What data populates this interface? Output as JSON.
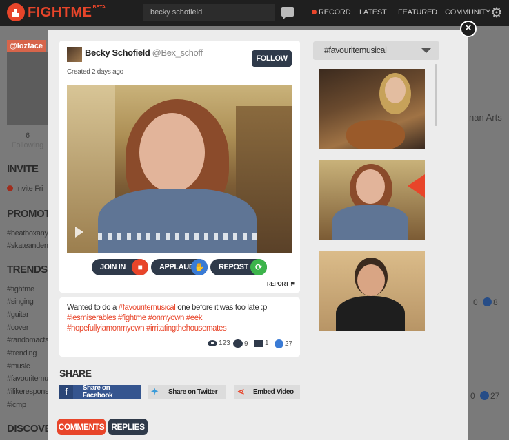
{
  "topbar": {
    "logo_text": "FIGHTME",
    "beta": "BETA",
    "search_value": "becky schofield",
    "nav": [
      "RECORD",
      "LATEST",
      "FEATURED",
      "COMMUNITY"
    ],
    "accent_color": "#e8452a"
  },
  "background": {
    "handle": "@lozface",
    "stat_value": "6",
    "stat_label": "Following",
    "invite_heading": "INVITE",
    "invite_link": "Invite Fri",
    "promoted_heading": "PROMOTED",
    "promoted": [
      "#beatboxanyv",
      "#skateandenj"
    ],
    "trends_heading": "TRENDS",
    "trends": [
      "#fightme",
      "#singing",
      "#guitar",
      "#cover",
      "#randomacts",
      "#trending",
      "#music",
      "#favouritemu",
      "#ilikerespons",
      "#icmp"
    ],
    "discover_heading": "DISCOVER",
    "right_text": "nan Arts",
    "right_count_a_left": "0",
    "right_count_a_right": "8",
    "right_count_b_left": "0",
    "right_count_b_right": "27"
  },
  "post": {
    "user_name": "Becky Schofield",
    "user_handle": "@Bex_schoff",
    "created": "Created 2 days ago",
    "follow_label": "FOLLOW",
    "actions": {
      "join": "JOIN IN",
      "applaud": "APPLAUD",
      "repost": "REPOST"
    },
    "report": "REPORT",
    "desc_prefix": "Wanted to do a ",
    "desc_tag": "#favouritemusical",
    "desc_suffix": " one before it was too late :p",
    "tags_line1": "#lesmiserables #fightme #onmyown #eek",
    "tags_line2": "#hopefullyiamonmyown #irritatingthehousemates",
    "stats": {
      "views": "123",
      "comments": "9",
      "joins": "1",
      "applauds": "27"
    }
  },
  "share": {
    "heading": "SHARE",
    "facebook": "Share on Facebook",
    "twitter": "Share on Twitter",
    "embed": "Embed Video"
  },
  "tabs": {
    "comments": "COMMENTS",
    "replies": "REPLIES"
  },
  "sidebar": {
    "dropdown_value": "#favouritemusical"
  }
}
